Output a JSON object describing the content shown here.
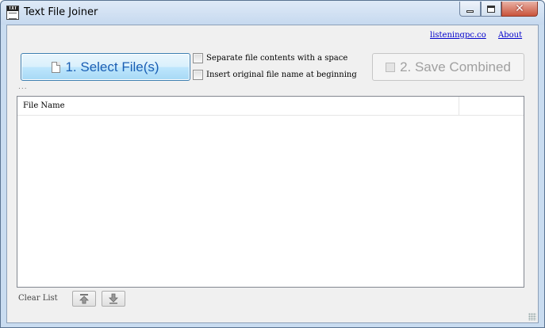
{
  "window": {
    "title": "Text File Joiner",
    "icon": "txt-file-icon"
  },
  "links": {
    "site": "listeningpc.co",
    "about": "About"
  },
  "actions": {
    "select_files": "1. Select File(s)",
    "save_combined": "2. Save Combined"
  },
  "options": {
    "separate_label": "Separate file contents with a space",
    "separate_checked": false,
    "insert_name_label": "Insert original file name at beginning",
    "insert_name_checked": false
  },
  "status_text": "...",
  "list": {
    "columns": [
      "File Name",
      ""
    ],
    "rows": []
  },
  "footer": {
    "clear_list": "Clear List",
    "move_up_icon": "move-top-icon",
    "move_down_icon": "move-down-icon"
  },
  "colors": {
    "primary_button_text": "#1a5fb4",
    "link": "#0000cc",
    "disabled_text": "#a0a0a0"
  }
}
